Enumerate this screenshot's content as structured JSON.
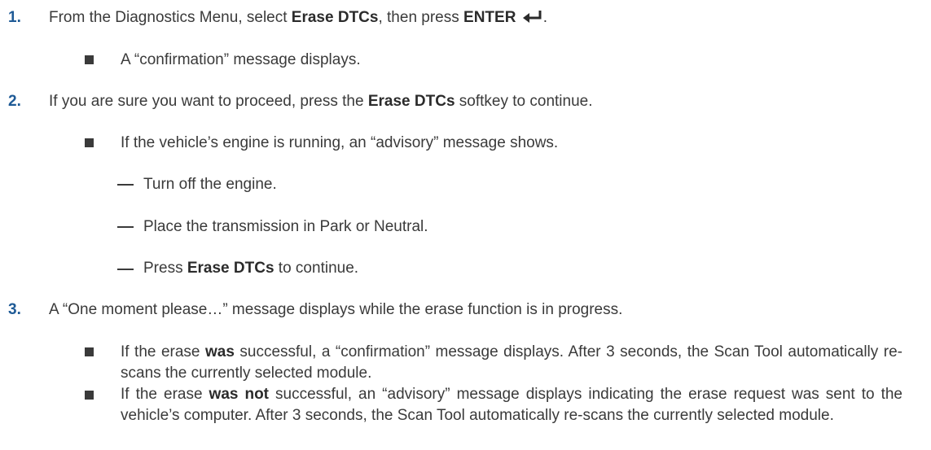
{
  "steps": [
    {
      "number": "1.",
      "parts": {
        "t1": "From the Diagnostics Menu, select ",
        "b1": "Erase DTCs",
        "t2": ", then press ",
        "b2": "ENTER",
        "t3": "."
      },
      "icon": "enter-key-icon",
      "bullets": [
        {
          "text": "A “confirmation” message displays."
        }
      ]
    },
    {
      "number": "2.",
      "parts": {
        "t1": "If you are sure you want to proceed, press the ",
        "b1": "Erase DTCs",
        "t2": " softkey to continue."
      },
      "bullets": [
        {
          "text": "If the vehicle’s engine is running, an “advisory” message shows."
        }
      ],
      "dashes": [
        {
          "text": "Turn off the engine."
        },
        {
          "text": "Place the transmission in Park or Neutral."
        },
        {
          "pre": "Press ",
          "bold": "Erase DTCs",
          "post": " to continue."
        }
      ]
    },
    {
      "number": "3.",
      "text": "A “One moment please…” message displays while the erase function is in progress.",
      "bullets": [
        {
          "pre": "If the erase ",
          "bold": "was",
          "post": " successful, a “confirmation” message displays. After 3 seconds, the Scan Tool automatically re-scans the currently selected module."
        },
        {
          "pre": "If the erase ",
          "bold": "was not",
          "post": " successful, an “advisory” message displays indicating the erase request was sent to the vehicle’s computer. After 3 seconds, the Scan Tool automatically re-scans the currently selected module."
        }
      ]
    }
  ],
  "colors": {
    "step_number": "#1e5a96",
    "text": "#3a3a3a"
  }
}
